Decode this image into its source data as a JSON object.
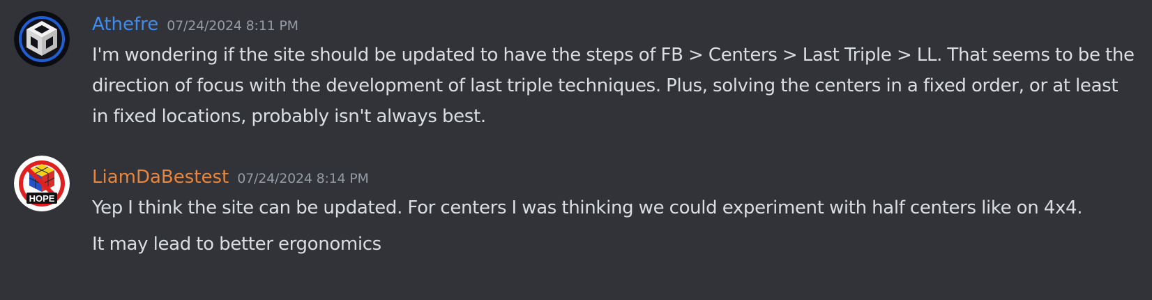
{
  "colors": {
    "background": "#313338",
    "text": "#dbdee1",
    "timestamp": "#949ba4",
    "user1": "#3f8cf0",
    "user2": "#e8853a"
  },
  "messages": [
    {
      "username": "Athefre",
      "timestamp": "07/24/2024 8:11 PM",
      "avatar_icon": "cube-logo-icon",
      "lines": [
        "I'm wondering if the site should be updated to have the steps of FB > Centers > Last Triple > LL. That seems to be the direction of focus with the development of last triple techniques. Plus, solving the centers in a fixed order, or at least in fixed locations, probably isn't always best."
      ]
    },
    {
      "username": "LiamDaBestest",
      "timestamp": "07/24/2024 8:14 PM",
      "avatar_icon": "no-hope-cube-icon",
      "avatar_text": "HOPE",
      "lines": [
        "Yep I think the site can be updated. For centers I was thinking we could experiment with half centers like on 4x4.",
        "It may lead to better ergonomics"
      ]
    }
  ]
}
